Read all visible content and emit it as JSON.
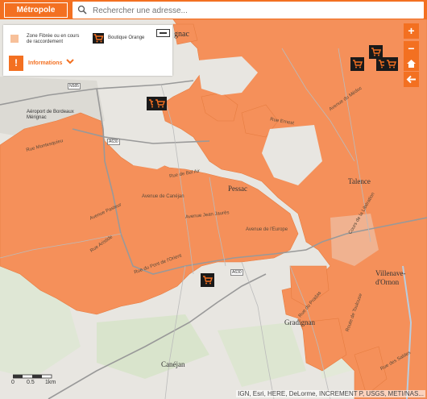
{
  "header": {
    "metro_label": "Métropole",
    "search_placeholder": "Rechercher une adresse..."
  },
  "legend": {
    "zone_label": "Zone Fibrée ou en cours de raccordement",
    "shop_label": "Boutique Orange",
    "info_label": "Informations"
  },
  "colors": {
    "brand": "#f37021",
    "fiber_zone": "#f5905a",
    "legend_swatch": "#f7c09a",
    "shop_badge": "#1a1a1a"
  },
  "controls": {
    "zoom_in": "+",
    "zoom_out": "−",
    "home_icon": "home-icon",
    "back_icon": "arrow-left-icon"
  },
  "places": {
    "pessac": "Pessac",
    "talence": "Talence",
    "villenave": "Villenave-d'Ornon",
    "gradignan": "Gradignan",
    "canejan": "Canéjan",
    "aeroport": "Aéroport de Bordeaux Mérignac",
    "bordeaux_fragment": "B",
    "gnac": "gnac"
  },
  "roads": {
    "n585": "N585",
    "a630a": "A630",
    "a630b": "A630"
  },
  "streets": {
    "s1": "Rue Montesquieu",
    "s2": "Avenue de Canéjan",
    "s3": "Rue de Bel Air",
    "s4": "Avenue Pasteur",
    "s5": "Avenue du Médoc",
    "s6": "Rue Ernest",
    "s7": "Avenue Jean Jaurès",
    "s8": "Rue Aristide",
    "s9": "Cours de la Libération",
    "s10": "Avenue de l'Europe",
    "s11": "Rue du Pont de l'Orient",
    "s12": "Rue du Pradas",
    "s13": "Route de Toulouse",
    "s14": "Rue des Sables"
  },
  "scale": {
    "t0": "0",
    "t1": "0.5",
    "t2": "1km"
  },
  "attribution": "IGN, Esri, HERE, DeLorme, INCREMENT P, USGS, METI/NAS..."
}
